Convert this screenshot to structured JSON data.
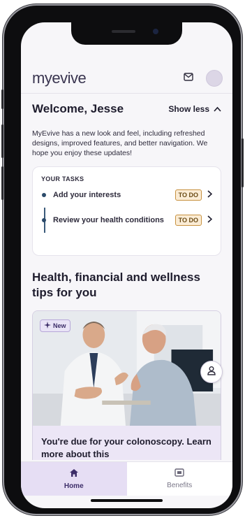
{
  "app": {
    "logo_prefix": "my",
    "logo_brand": "evive"
  },
  "welcome": {
    "title": "Welcome, Jesse",
    "toggle_label": "Show less",
    "intro_text": "MyEvive has a new look and feel, including refreshed designs, improved features, and better navigation. We hope you enjoy these updates!"
  },
  "tasks": {
    "heading": "YOUR TASKS",
    "items": [
      {
        "label": "Add your interests",
        "status": "TO DO"
      },
      {
        "label": "Review your health conditions",
        "status": "TO DO"
      }
    ]
  },
  "tips": {
    "heading": "Health, financial and wellness tips for you",
    "card": {
      "badge": "New",
      "caption": "You're due for your colonoscopy. Learn more about this"
    }
  },
  "bottom_nav": {
    "items": [
      {
        "label": "Home",
        "icon": "home-icon",
        "active": true
      },
      {
        "label": "Benefits",
        "icon": "benefits-icon",
        "active": false
      }
    ]
  },
  "colors": {
    "accent": "#3d2e69",
    "todo_bg": "#fbecd5",
    "nav_active_bg": "#e6def4"
  }
}
